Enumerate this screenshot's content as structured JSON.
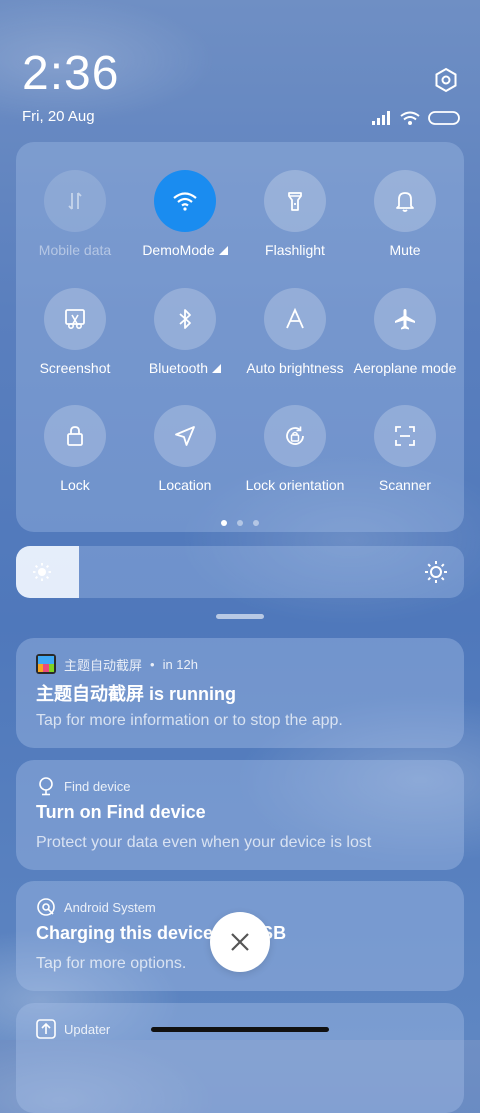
{
  "status": {
    "time": "2:36",
    "date": "Fri, 20 Aug"
  },
  "icons": {
    "settings": "settings-hexagon-icon",
    "signal": "signal-bars-icon",
    "wifi": "wifi-icon",
    "battery": "battery-icon"
  },
  "quick_settings": {
    "tiles": [
      {
        "label": "Mobile data",
        "icon": "mobile-data-icon",
        "state": "disabled"
      },
      {
        "label": "DemoMode",
        "icon": "wifi-icon",
        "state": "active"
      },
      {
        "label": "Flashlight",
        "icon": "flashlight-icon",
        "state": "off"
      },
      {
        "label": "Mute",
        "icon": "bell-icon",
        "state": "off"
      },
      {
        "label": "Screenshot",
        "icon": "screenshot-icon",
        "state": "off"
      },
      {
        "label": "Bluetooth",
        "icon": "bluetooth-icon",
        "state": "off"
      },
      {
        "label": "Auto brightness",
        "icon": "auto-brightness-icon",
        "state": "off"
      },
      {
        "label": "Aeroplane mode",
        "icon": "airplane-icon",
        "state": "off"
      },
      {
        "label": "Lock",
        "icon": "lock-icon",
        "state": "off"
      },
      {
        "label": "Location",
        "icon": "location-arrow-icon",
        "state": "off"
      },
      {
        "label": "Lock orientation",
        "icon": "rotation-lock-icon",
        "state": "off"
      },
      {
        "label": "Scanner",
        "icon": "scanner-icon",
        "state": "off"
      }
    ],
    "page_count": 3,
    "current_page": 1
  },
  "brightness": {
    "level": 0.14
  },
  "notifications": [
    {
      "app": "主题自动截屏",
      "time": "in 12h",
      "title": "主题自动截屏 is running",
      "text": "Tap for more information or to stop the app.",
      "icon": "app-image-icon"
    },
    {
      "app": "Find device",
      "time": "",
      "title": "Turn on Find device",
      "text": "Protect your data even when your device is lost",
      "icon": "find-device-icon"
    },
    {
      "app": "Android System",
      "time": "",
      "title": "Charging this device via USB",
      "text": "Tap for more options.",
      "icon": "android-system-icon"
    },
    {
      "app": "Updater",
      "time": "",
      "title": "",
      "text": "",
      "icon": "updater-icon"
    }
  ],
  "colors": {
    "active_tile": "#1a8cf0"
  }
}
